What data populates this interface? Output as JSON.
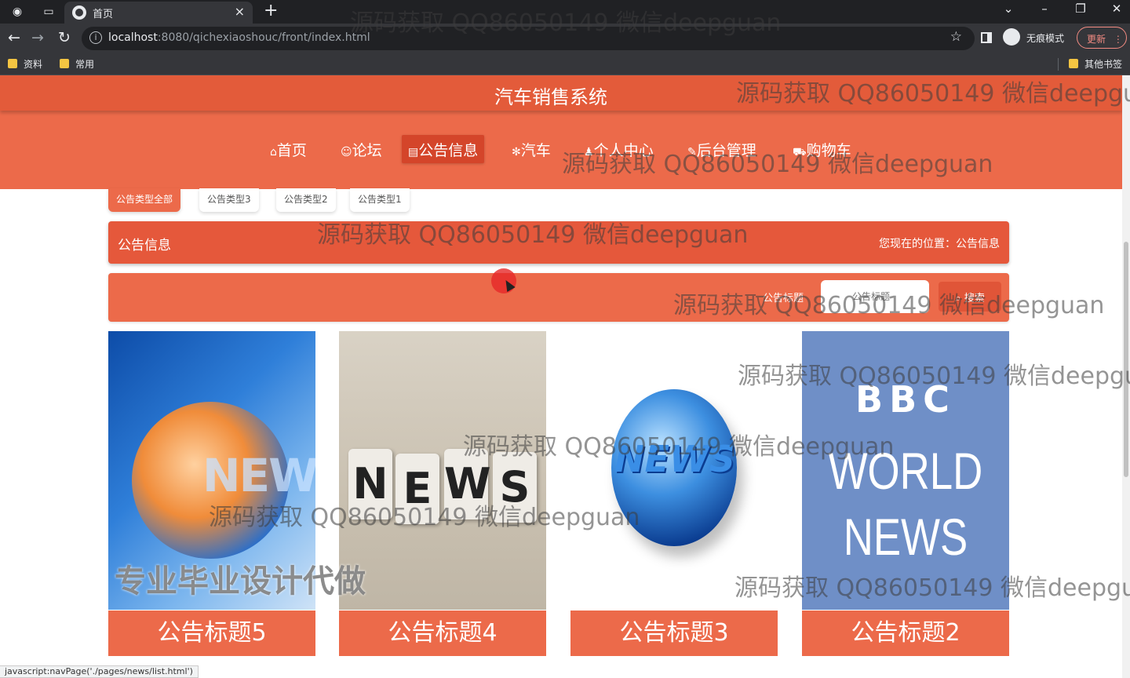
{
  "browser": {
    "tab_title": "首页",
    "url_host": "localhost",
    "url_rest": ":8080/qichexiaoshouc/front/index.html",
    "incognito_label": "无痕模式",
    "update_label": "更新",
    "bookmarks": [
      "资料",
      "常用"
    ],
    "other_bookmarks": "其他书签",
    "status_url": "javascript:navPage('./pages/news/list.html')"
  },
  "site": {
    "title": "汽车销售系统",
    "menu": [
      {
        "icon": "home-icon",
        "glyph": "⌂",
        "label": "首页",
        "active": false
      },
      {
        "icon": "forum-icon",
        "glyph": "☺",
        "label": "论坛",
        "active": false
      },
      {
        "icon": "notice-icon",
        "glyph": "▤",
        "label": "公告信息",
        "active": true
      },
      {
        "icon": "car-icon",
        "glyph": "✻",
        "label": "汽车",
        "active": false
      },
      {
        "icon": "user-icon",
        "glyph": "♟",
        "label": "个人中心",
        "active": false
      },
      {
        "icon": "admin-icon",
        "glyph": "✎",
        "label": "后台管理",
        "active": false
      },
      {
        "icon": "cart-icon",
        "glyph": "⛟",
        "label": "购物车",
        "active": false
      }
    ]
  },
  "filters": [
    "公告类型全部",
    "公告类型3",
    "公告类型2",
    "公告类型1"
  ],
  "breadcrumb": {
    "title": "公告信息",
    "location": "您现在的位置：公告信息"
  },
  "search": {
    "label": "公告标题",
    "placeholder": "公告标题",
    "button": "搜索"
  },
  "cards": [
    {
      "title": "公告标题5",
      "image": "news-globe-image"
    },
    {
      "title": "公告标题4",
      "image": "news-cubes-image"
    },
    {
      "title": "公告标题3",
      "image": "news-earth-image"
    },
    {
      "title": "公告标题2",
      "image": "bbc-world-news-image"
    }
  ],
  "watermark": "源码获取 QQ86050149 微信deepguan",
  "watermark_ad": "专业毕业设计代做",
  "colors": {
    "accent": "#ec6a4a",
    "accent_dark": "#e5583b"
  }
}
